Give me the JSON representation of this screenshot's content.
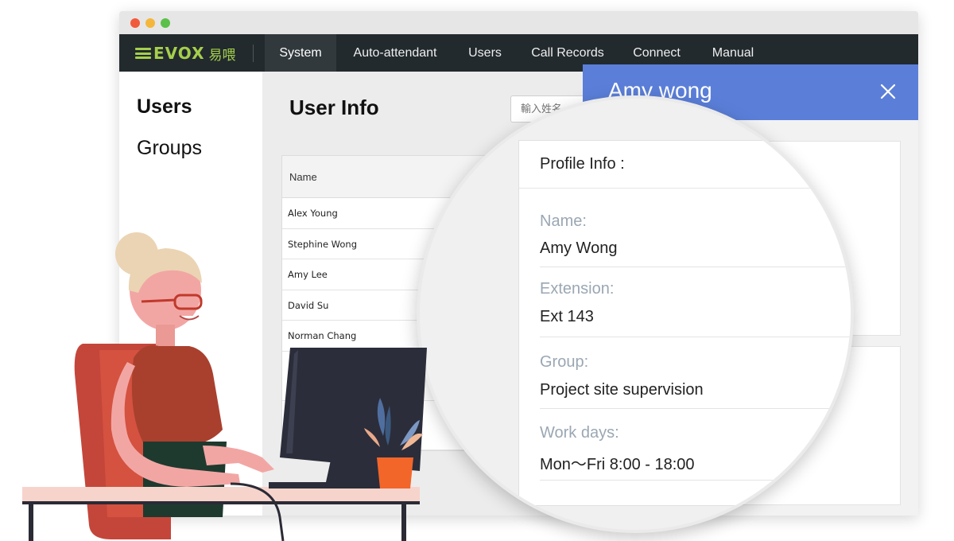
{
  "brand": {
    "name": "EVOX",
    "cjk": "易喂"
  },
  "nav": {
    "items": [
      {
        "label": "System",
        "active": true
      },
      {
        "label": "Auto-attendant",
        "active": false
      },
      {
        "label": "Users",
        "active": false
      },
      {
        "label": "Call Records",
        "active": false
      },
      {
        "label": "Connect",
        "active": false
      },
      {
        "label": "Manual",
        "active": false
      }
    ]
  },
  "sidebar": {
    "items": [
      {
        "label": "Users"
      },
      {
        "label": "Groups"
      }
    ]
  },
  "main": {
    "title": "User Info",
    "search_placeholder": "輸入姓名",
    "table": {
      "header": "Name",
      "rows": [
        "Alex Young",
        "Stephine Wong",
        "Amy Lee",
        "David Su",
        "Norman Chang"
      ]
    }
  },
  "drawer": {
    "title": "Amy wong"
  },
  "profile": {
    "title": "Profile Info :",
    "fields": [
      {
        "label": "Name:",
        "value": "Amy Wong"
      },
      {
        "label": "Extension:",
        "value": "Ext 143"
      },
      {
        "label": "Group:",
        "value": "Project site supervision"
      },
      {
        "label": "Work days:",
        "value": "Mon～Fri 8:00 - 18:00"
      }
    ]
  },
  "colors": {
    "navbar": "#222a2e",
    "brand": "#a5cf4b",
    "drawer_header": "#5b7fd9",
    "field_label": "#9aa7b3"
  }
}
